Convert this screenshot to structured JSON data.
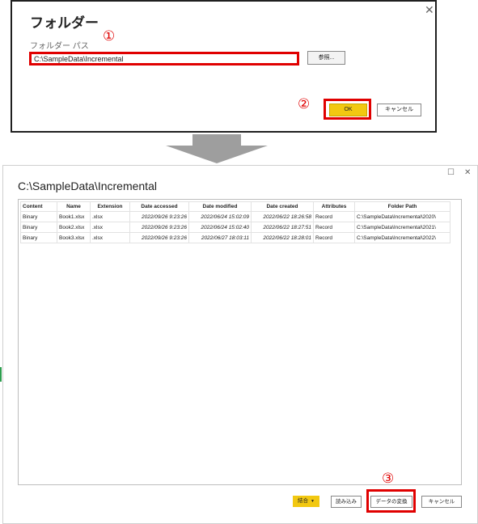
{
  "folder_dialog": {
    "title": "フォルダー",
    "close_symbol": "✕",
    "path_label": "フォルダー パス",
    "path_value": "C:\\SampleData\\Incremental",
    "browse_label": "参照...",
    "ok_label": "OK",
    "cancel_label": "キャンセル"
  },
  "markers": {
    "one": "①",
    "two": "②",
    "three": "③"
  },
  "preview_dialog": {
    "title": "C:\\SampleData\\Incremental",
    "maximize_symbol": "☐",
    "close_symbol": "✕",
    "columns": [
      "Content",
      "Name",
      "Extension",
      "Date accessed",
      "Date modified",
      "Date created",
      "Attributes",
      "Folder Path"
    ],
    "rows": [
      [
        "Binary",
        "Book1.xlsx",
        ".xlsx",
        "2022/09/26 9:23:26",
        "2022/06/24 15:02:09",
        "2022/06/22 18:26:58",
        "Record",
        "C:\\SampleData\\Incremental\\2020\\"
      ],
      [
        "Binary",
        "Book2.xlsx",
        ".xlsx",
        "2022/09/26 9:23:26",
        "2022/06/24 15:02:40",
        "2022/06/22 18:27:51",
        "Record",
        "C:\\SampleData\\Incremental\\2021\\"
      ],
      [
        "Binary",
        "Book3.xlsx",
        ".xlsx",
        "2022/09/26 9:23:26",
        "2022/06/27 18:03:11",
        "2022/06/22 18:28:01",
        "Record",
        "C:\\SampleData\\Incremental\\2022\\"
      ]
    ],
    "combine_label": "結合",
    "load_label": "読み込み",
    "transform_label": "データの変換",
    "cancel_label": "キャンセル"
  },
  "colors": {
    "accent_yellow": "#f2c811",
    "highlight_red": "#e00000",
    "arrow_gray": "#9e9e9e"
  }
}
